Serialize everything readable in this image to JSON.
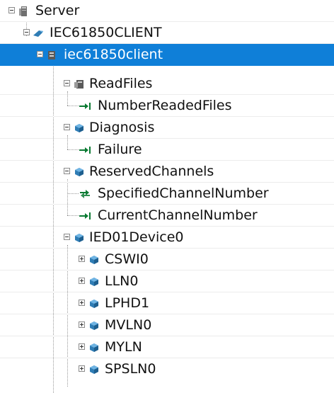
{
  "tree": {
    "server": "Server",
    "client": "IEC61850CLIENT",
    "instance": "iec61850client",
    "readfiles": "ReadFiles",
    "number_readed_files": "NumberReadedFiles",
    "diagnosis": "Diagnosis",
    "failure": "Failure",
    "reserved_channels": "ReservedChannels",
    "specified_channel_number": "SpecifiedChannelNumber",
    "current_channel_number": "CurrentChannelNumber",
    "device": "IED01Device0",
    "ln_cswi0": "CSWI0",
    "ln_lln0": "LLN0",
    "ln_lphd1": "LPHD1",
    "ln_mvln0": "MVLN0",
    "ln_myln": "MYLN",
    "ln_spsln0": "SPSLN0"
  },
  "colors": {
    "selection": "#0f7fd8",
    "object_icon": "#2f7db5",
    "variable_arrow": "#0a7a32"
  },
  "icons": [
    "server-icon",
    "client-icon",
    "instance-icon",
    "folder-icon",
    "object-icon",
    "variable-out-icon",
    "variable-inout-icon"
  ]
}
